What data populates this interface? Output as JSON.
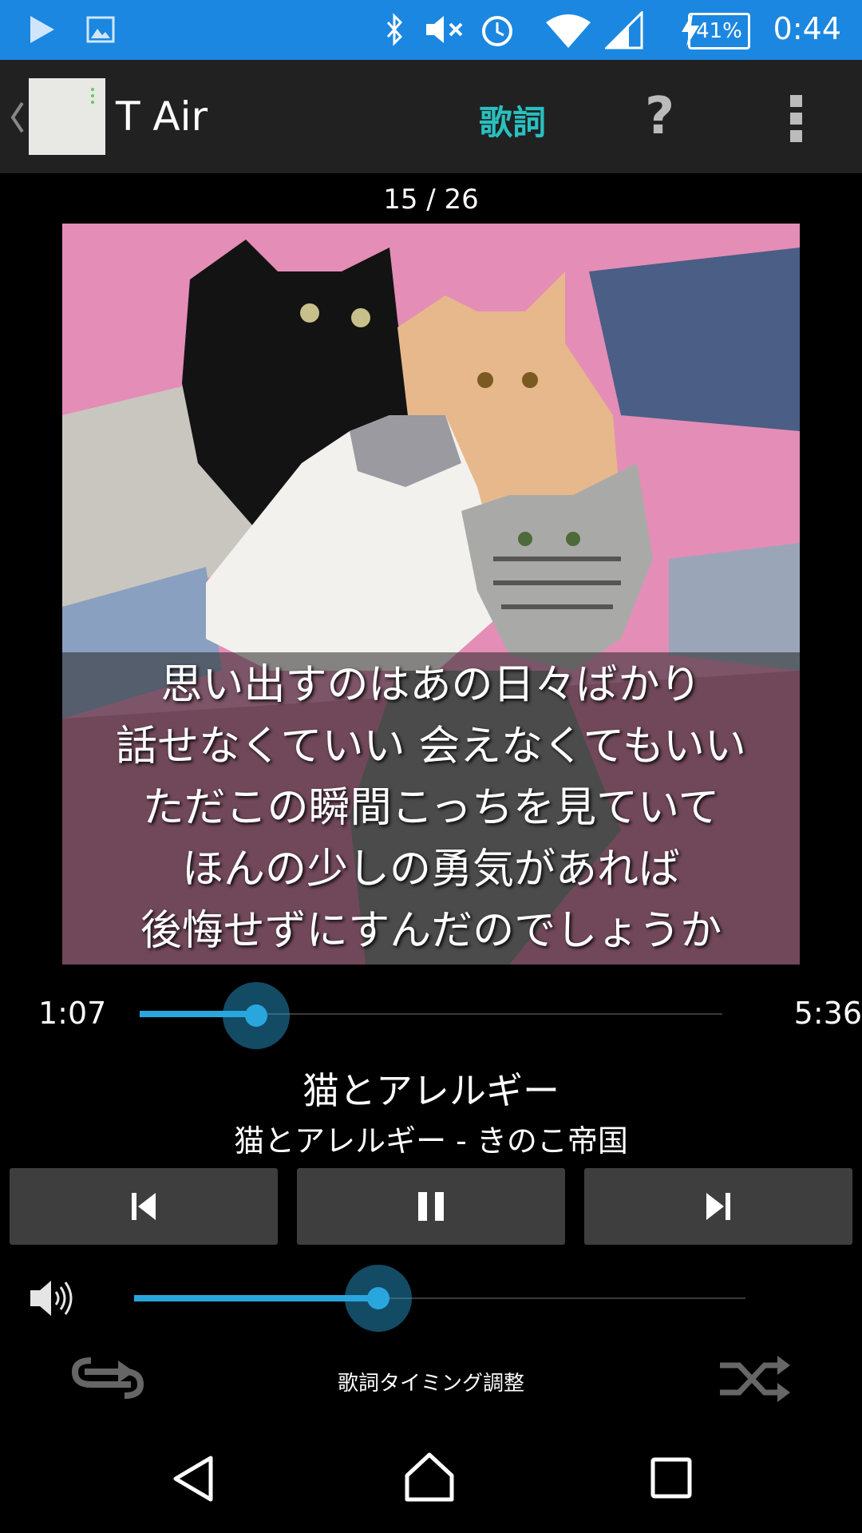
{
  "status_bar": {
    "time": "0:44",
    "battery": "41%",
    "icons": [
      "play-icon",
      "gallery-icon",
      "bluetooth-icon",
      "mute-icon",
      "alarm-icon",
      "wifi-icon",
      "signal-icon",
      "charging-icon"
    ]
  },
  "app_bar": {
    "title": "T Air",
    "lyrics_label": "歌詞",
    "help_label": "?"
  },
  "track_counter": "15 / 26",
  "lyrics": [
    "思い出すのはあの日々ばかり",
    "話せなくていい 会えなくてもいい",
    "ただこの瞬間こっちを見ていて",
    "ほんの少しの勇気があれば",
    "後悔せずにすんだのでしょうか"
  ],
  "seek": {
    "elapsed": "1:07",
    "duration": "5:36",
    "progress": 0.2
  },
  "song": {
    "title": "猫とアレルギー",
    "subtitle": "猫とアレルギー - きのこ帝国"
  },
  "volume": {
    "level": 0.4
  },
  "timing_label": "歌詞タイミング調整",
  "colors": {
    "accent": "#2aa6de",
    "status_bar": "#1b87e0",
    "lyrics_tab": "#29c0c0",
    "app_bar": "#212121"
  }
}
